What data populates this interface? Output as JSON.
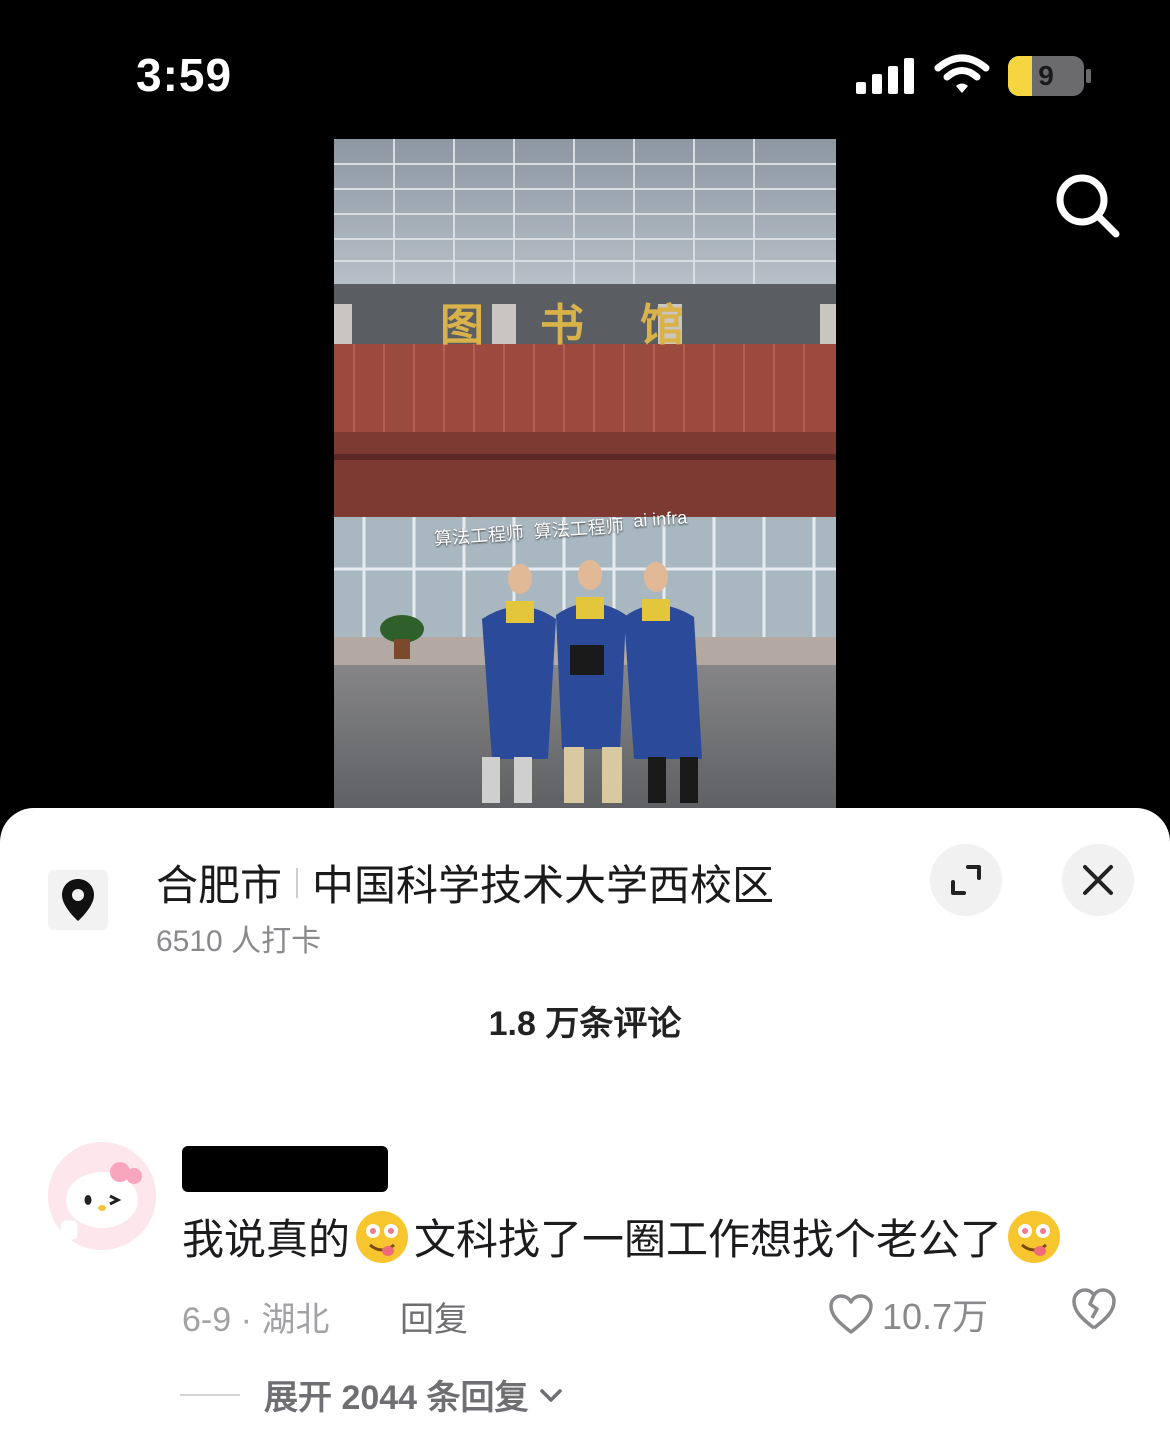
{
  "status_bar": {
    "time": "3:59",
    "battery_level": "9"
  },
  "video": {
    "overlay_labels": [
      "算法工程师",
      "算法工程师",
      "ai infra"
    ],
    "sign_text": "图书馆"
  },
  "location": {
    "city": "合肥市",
    "place": "中国科学技术大学西校区",
    "checkins": "6510 人打卡"
  },
  "comments_header": {
    "count_label": "1.8 万条评论"
  },
  "comment": {
    "text_part1": "我说真的",
    "text_part2": "文科找了一圈工作想找个老公了",
    "date_location": "6-9 · 湖北",
    "reply_label": "回复",
    "like_count": "10.7万",
    "expand_replies_label": "展开 2044 条回复"
  },
  "icons": [
    "signal-icon",
    "wifi-icon",
    "battery-icon",
    "search-icon",
    "location-pin-icon",
    "expand-icon",
    "close-icon",
    "heart-icon",
    "broken-heart-icon",
    "chevron-down-icon"
  ]
}
